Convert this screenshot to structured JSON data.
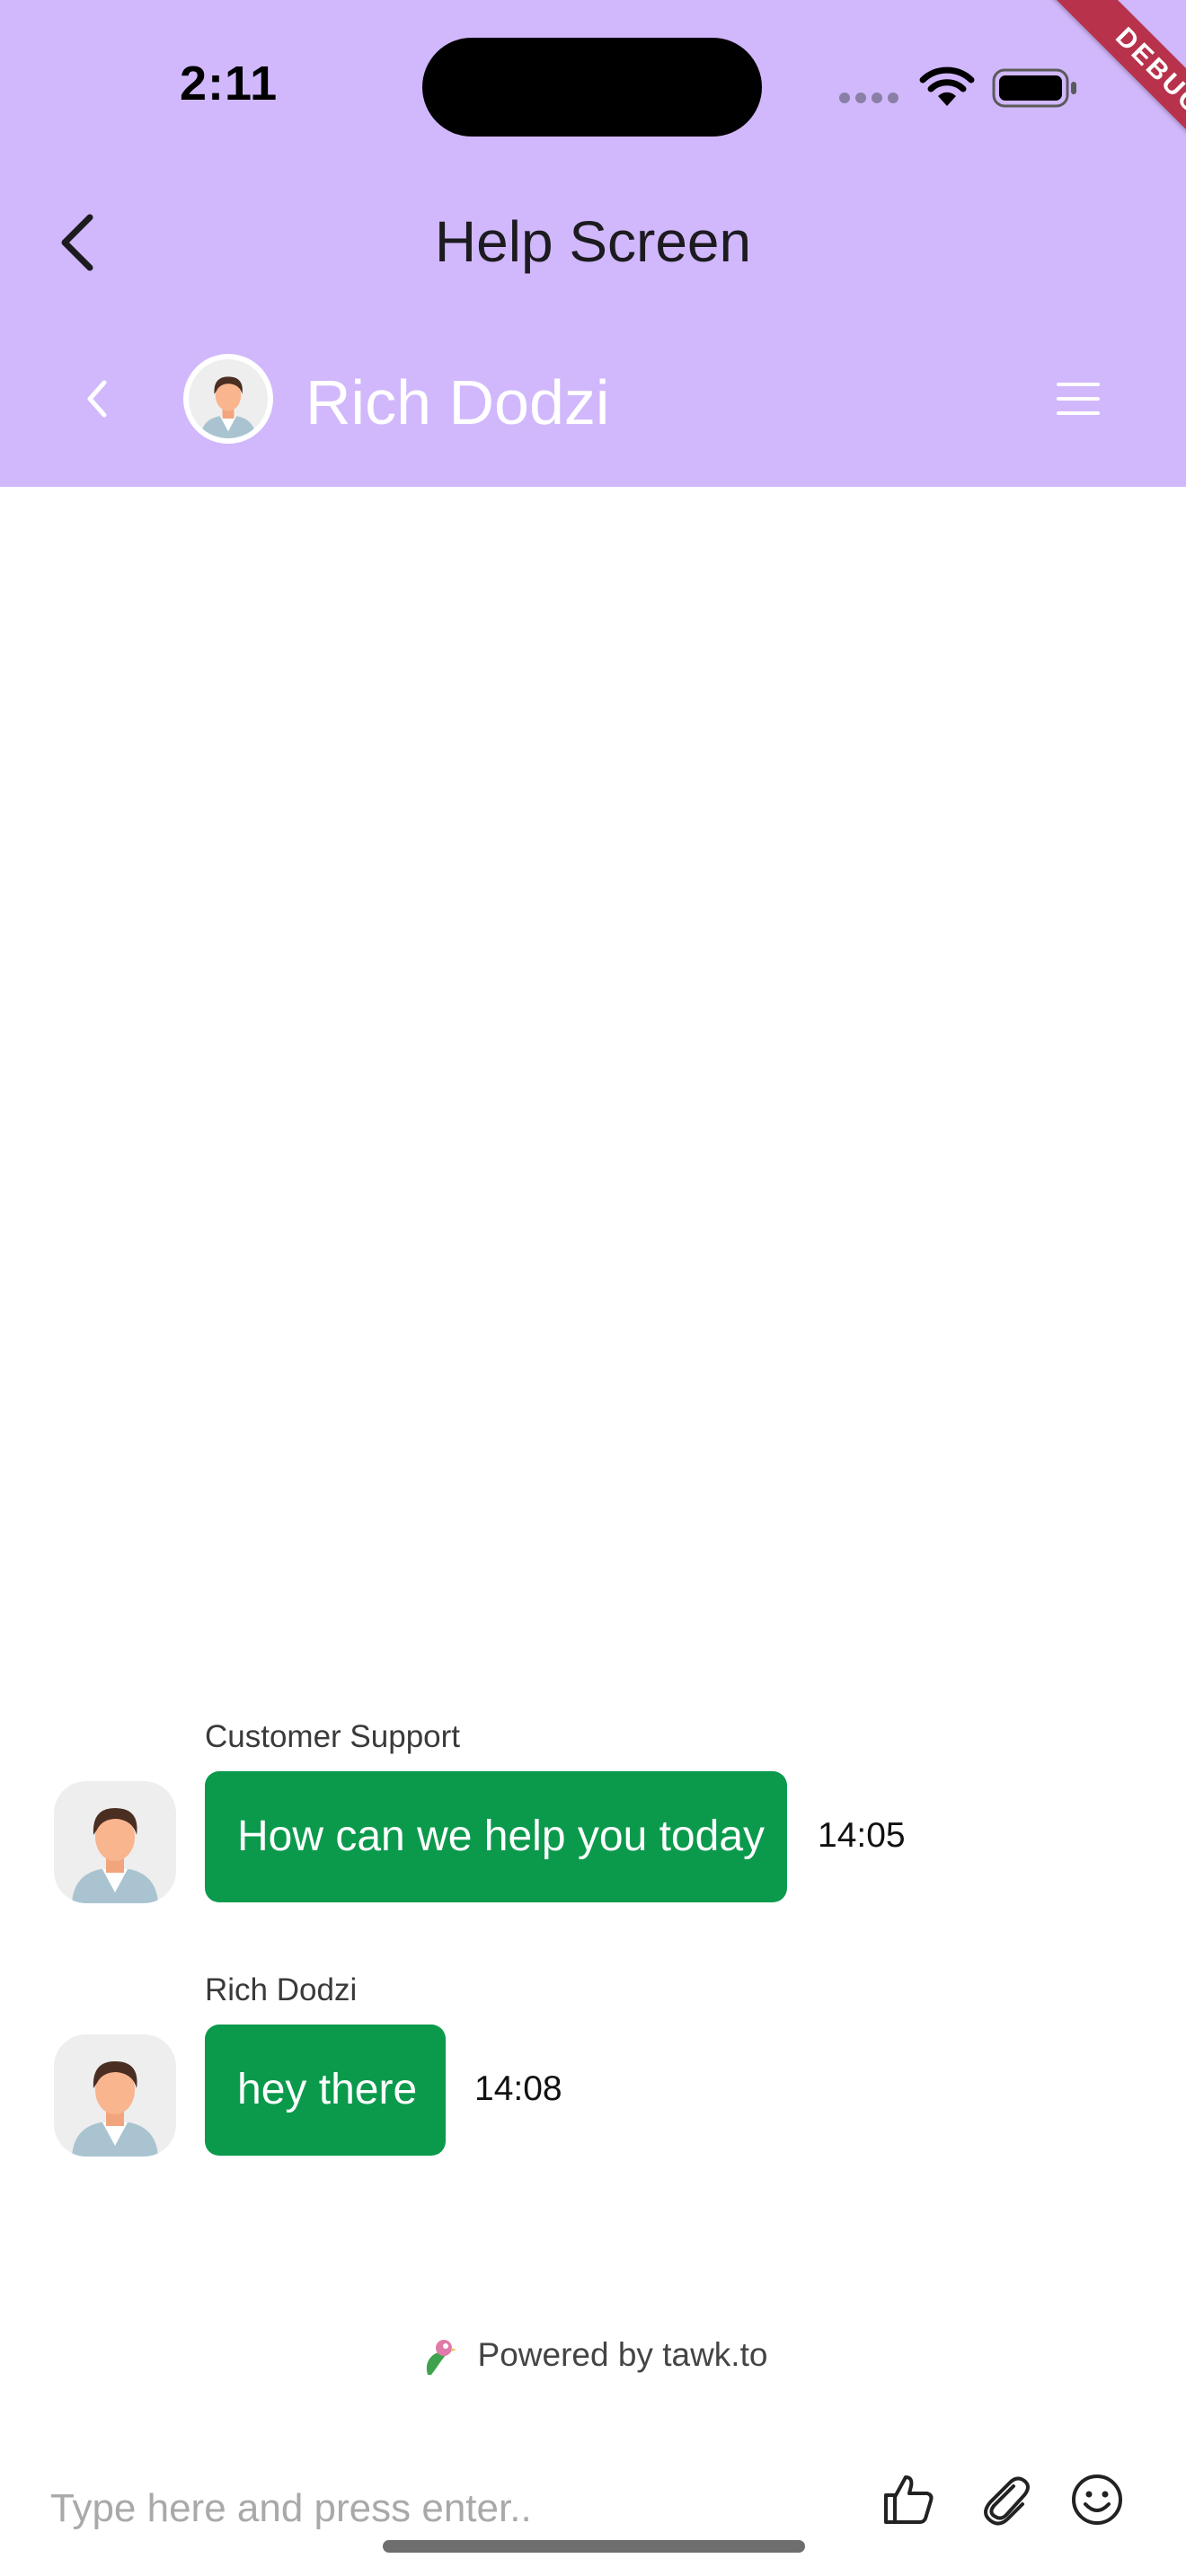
{
  "status_bar": {
    "time": "2:11"
  },
  "debug_banner": "DEBUG",
  "nav": {
    "title": "Help Screen"
  },
  "chat_header": {
    "name": "Rich Dodzi"
  },
  "messages": [
    {
      "sender": "Customer Support",
      "text": "How can we help you today",
      "time": "14:05"
    },
    {
      "sender": "Rich Dodzi",
      "text": "hey there",
      "time": "14:08"
    }
  ],
  "footer": {
    "powered_by": "Powered by tawk.to",
    "input_placeholder": "Type here and press enter.."
  },
  "icons": {
    "nav_back": "chevron-left-icon",
    "chat_back": "chevron-left-icon",
    "menu": "hamburger-icon",
    "like": "thumbs-up-icon",
    "attach": "paperclip-icon",
    "emoji": "smiley-icon"
  },
  "colors": {
    "header_bg": "#d1b8fc",
    "bubble_bg": "#0b9a4c",
    "debug_ribbon": "#b7324a"
  }
}
